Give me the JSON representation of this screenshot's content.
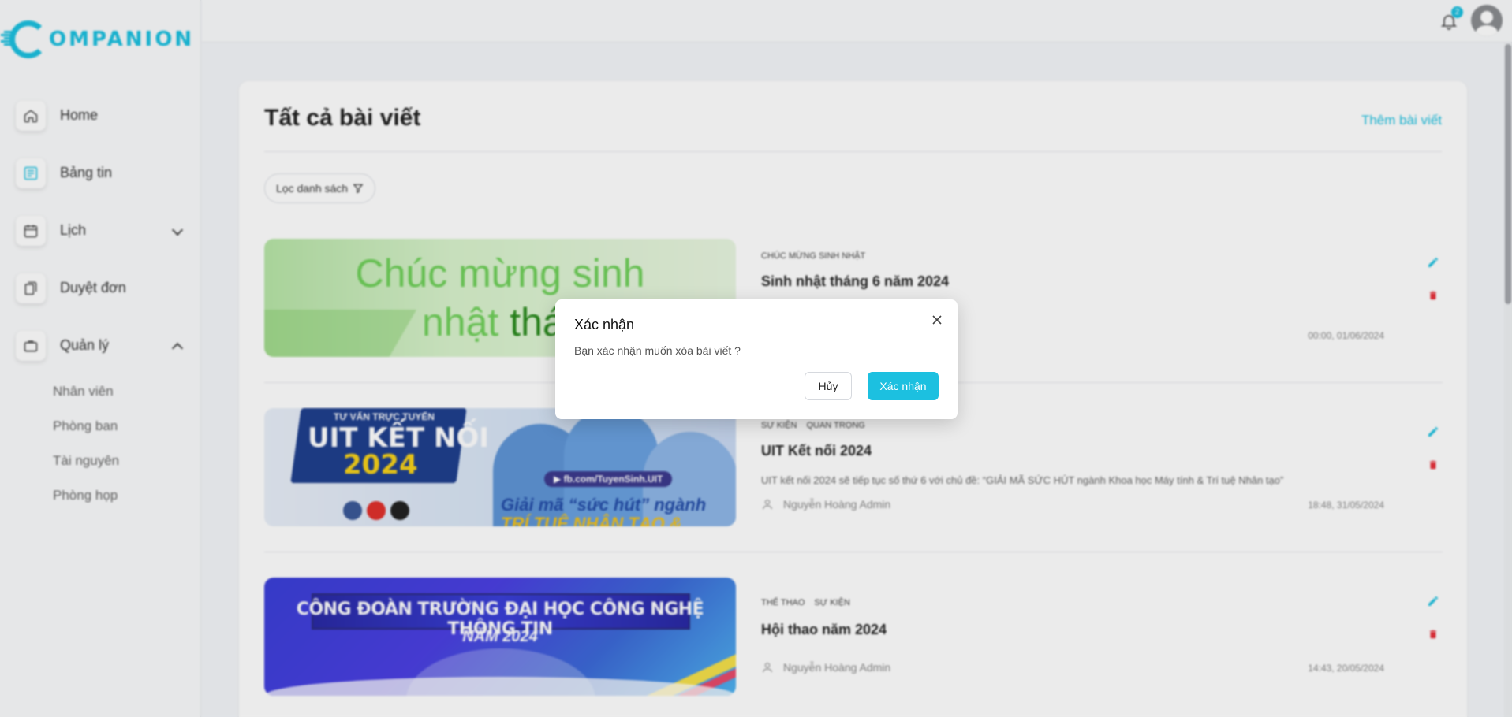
{
  "brand": {
    "logo_text": "OMPANION"
  },
  "sidebar": {
    "items": [
      {
        "label": "Home",
        "icon": "home-icon"
      },
      {
        "label": "Bảng tin",
        "icon": "newspaper-icon"
      },
      {
        "label": "Lịch",
        "icon": "calendar-icon"
      },
      {
        "label": "Duyệt đơn",
        "icon": "documents-icon"
      },
      {
        "label": "Quản lý",
        "icon": "briefcase-icon"
      }
    ],
    "subitems": [
      "Nhân viên",
      "Phòng ban",
      "Tài nguyên",
      "Phòng họp"
    ]
  },
  "topbar": {
    "notification_count": "2"
  },
  "main": {
    "title": "Tất cả bài viết",
    "add_label": "Thêm bài viết",
    "filter_label": "Lọc danh sách"
  },
  "posts": [
    {
      "tags": [
        "CHÚC MỪNG SINH NHẬT"
      ],
      "title": "Sinh nhật tháng 6 năm 2024",
      "description": "",
      "author": "",
      "time": "00:00, 01/06/2024",
      "thumb_text_1": "Chúc mừng sinh",
      "thumb_text_2a": "nhật ",
      "thumb_text_2b": "thá"
    },
    {
      "tags": [
        "SỰ KIỆN",
        "QUAN TRỌNG"
      ],
      "title": "UIT Kết nối 2024",
      "description": "UIT kết nối 2024 sẽ tiếp tục số thứ 6 với chủ đề: “GIẢI MÃ SỨC HÚT ngành Khoa học Máy tính & Trí tuệ Nhân tạo”",
      "author": "Nguyễn Hoàng Admin",
      "time": "18:48, 31/05/2024",
      "thumb_line1": "TƯ VẤN TRỰC TUYẾN",
      "thumb_line2": "UIT KẾT NỐI",
      "thumb_line3": "2024",
      "thumb_fb": "▶ fb.com/TuyenSinh.UIT",
      "thumb_slogan": "Giải mã “sức hút” ngành",
      "thumb_slogan2": "TRÍ TUỆ NHÂN TẠO &"
    },
    {
      "tags": [
        "THỂ THAO",
        "SỰ KIỆN"
      ],
      "title": "Hội thao năm 2024",
      "description": "",
      "author": "Nguyễn Hoàng Admin",
      "time": "14:43, 20/05/2024",
      "thumb_line1": "CÔNG ĐOÀN TRƯỜNG ĐẠI HỌC CÔNG NGHỆ THÔNG TIN",
      "thumb_line2": "NĂM 2024"
    }
  ],
  "modal": {
    "title": "Xác nhận",
    "message": "Bạn xác nhận muốn xóa bài viết ?",
    "cancel_label": "Hủy",
    "confirm_label": "Xác nhận"
  },
  "colors": {
    "accent": "#1cc0e0",
    "danger": "#e8323c",
    "edit": "#1cc0e0"
  }
}
